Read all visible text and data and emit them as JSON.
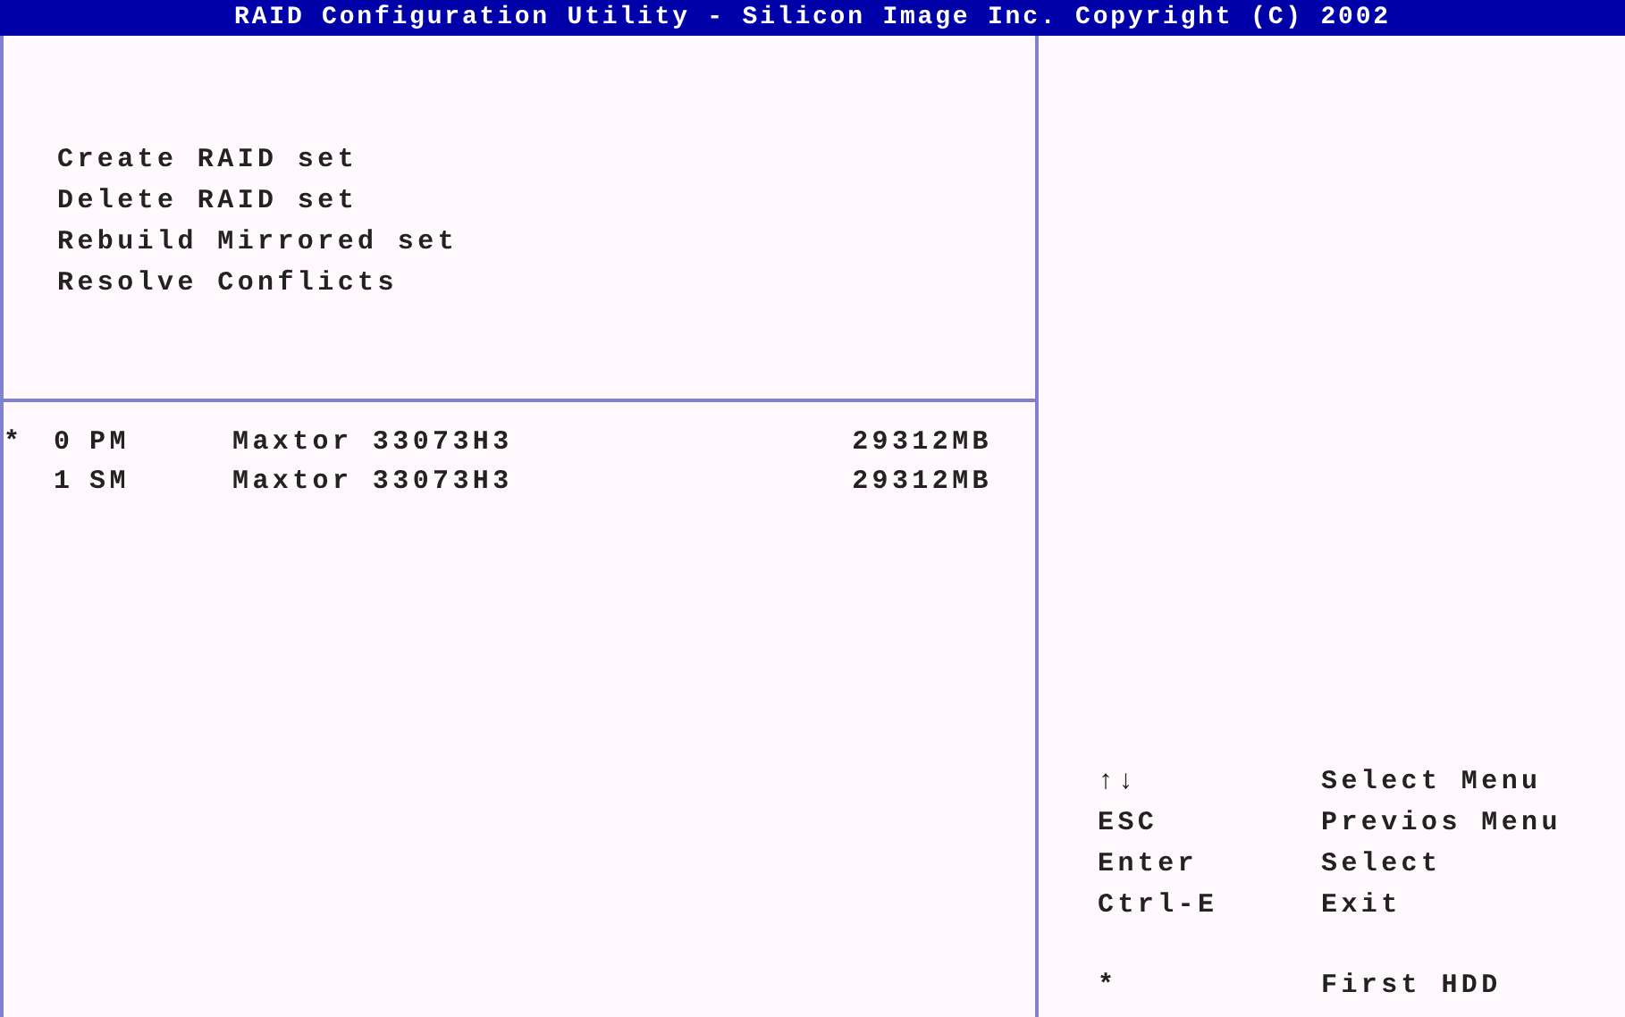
{
  "title": "RAID Configuration Utility - Silicon Image Inc. Copyright (C) 2002",
  "menu": [
    {
      "label": "Create RAID set",
      "selected": false
    },
    {
      "label": "Delete RAID set",
      "selected": false
    },
    {
      "label": "Rebuild Mirrored set",
      "selected": false
    },
    {
      "label": "Resolve Conflicts",
      "selected": false
    }
  ],
  "disks": [
    {
      "marker": "*",
      "index": "0",
      "role": "PM",
      "model": "Maxtor 33073H3",
      "size": "29312MB"
    },
    {
      "index": "1",
      "role": "SM",
      "model": "Maxtor 33073H3",
      "size": "29312MB"
    }
  ],
  "keys": [
    {
      "key": "↑↓",
      "action": "Select Menu"
    },
    {
      "key": "ESC",
      "action": "Previos Menu"
    },
    {
      "key": "Enter",
      "action": "Select"
    },
    {
      "key": "Ctrl-E",
      "action": "Exit"
    }
  ],
  "legend": {
    "key": "*",
    "action": "First HDD"
  }
}
